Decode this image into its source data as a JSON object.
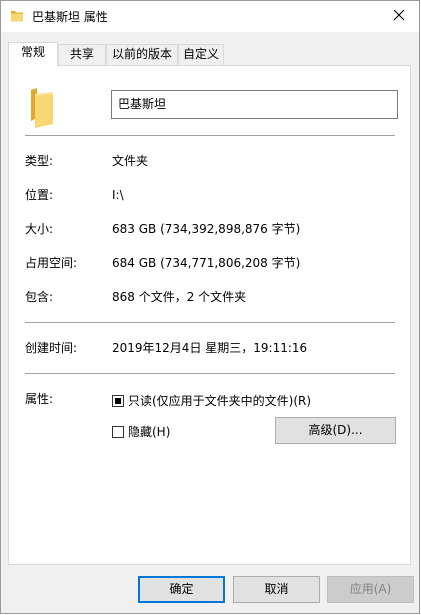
{
  "window": {
    "title": "巴基斯坦 属性"
  },
  "tabs": [
    {
      "label": "常规",
      "active": true
    },
    {
      "label": "共享",
      "active": false
    },
    {
      "label": "以前的版本",
      "active": false
    },
    {
      "label": "自定义",
      "active": false
    }
  ],
  "general": {
    "name_value": "巴基斯坦",
    "type_label": "类型:",
    "type_value": "文件夹",
    "location_label": "位置:",
    "location_value": "I:\\",
    "size_label": "大小:",
    "size_value": "683 GB (734,392,898,876 字节)",
    "size_on_disk_label": "占用空间:",
    "size_on_disk_value": "684 GB (734,771,806,208 字节)",
    "contains_label": "包含:",
    "contains_value": "868 个文件，2 个文件夹",
    "created_label": "创建时间:",
    "created_value": "2019年12月4日 星期三，19:11:16",
    "attributes_label": "属性:",
    "readonly_label": "只读(仅应用于文件夹中的文件)(R)",
    "readonly_state": "mixed",
    "hidden_label": "隐藏(H)",
    "hidden_checked": false,
    "advanced_button": "高级(D)..."
  },
  "footer": {
    "ok_button": "确定",
    "cancel_button": "取消",
    "apply_button": "应用(A)"
  },
  "colors": {
    "folder_yellow": "#f8d775",
    "folder_dark": "#e0a82e",
    "accent": "#0078d7"
  },
  "icons": {
    "title_icon": "folder-icon",
    "close_icon": "close-icon",
    "main_icon": "folder-icon"
  }
}
